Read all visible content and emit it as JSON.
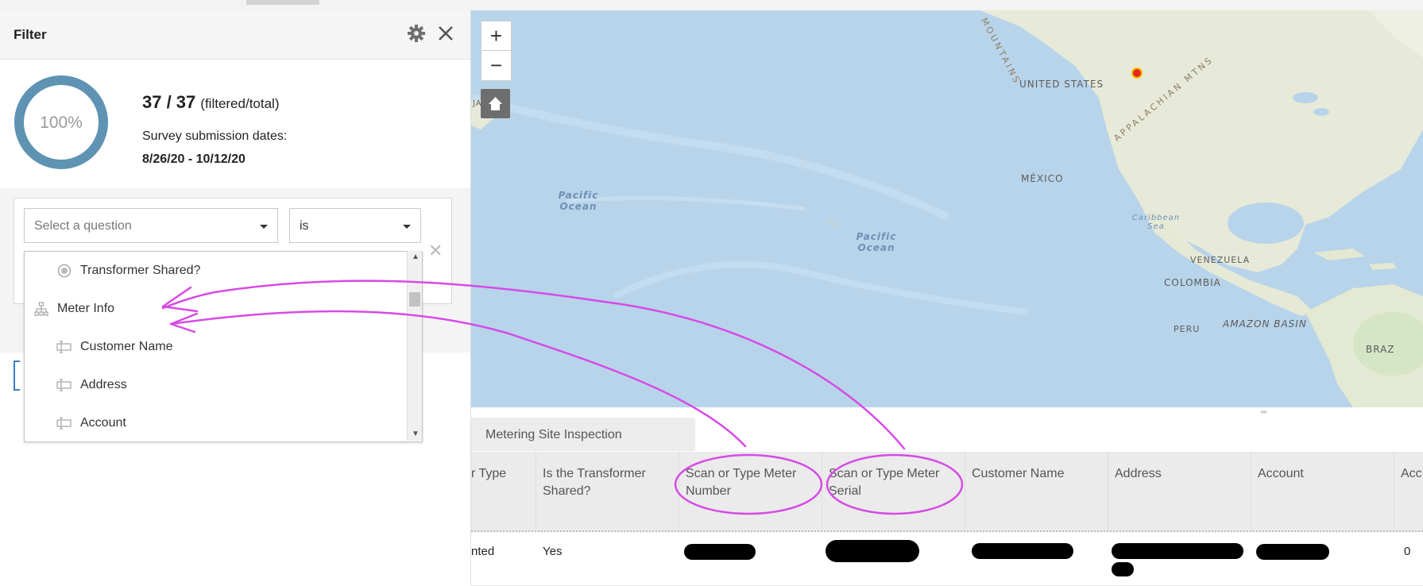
{
  "filter_panel": {
    "title": "Filter",
    "progress": {
      "percent_label": "100%",
      "percent": 100,
      "counts": "37 / 37",
      "counts_suffix": "(filtered/total)",
      "dates_label": "Survey submission dates:",
      "dates_value": "8/26/20 - 10/12/20"
    },
    "question_select": {
      "value": "Select a question"
    },
    "operator_select": {
      "value": "is"
    },
    "dropdown_items": [
      {
        "label": "Transformer Shared?",
        "icon": "radio-icon"
      },
      {
        "label": "Meter Info",
        "icon": "group-icon"
      },
      {
        "label": "Customer Name",
        "icon": "text-field-icon"
      },
      {
        "label": "Address",
        "icon": "text-field-icon"
      },
      {
        "label": "Account",
        "icon": "text-field-icon"
      }
    ]
  },
  "map": {
    "labels": {
      "united_states": "UNITED STATES",
      "mexico": "MÉXICO",
      "pacific1": "Pacific Ocean",
      "pacific2": "Pacific Ocean",
      "caribbean": "Caribbean Sea",
      "venezuela": "VENEZUELA",
      "colombia": "COLOMBIA",
      "peru": "PERU",
      "amazon": "AMAZON BASIN",
      "brazil": "BRAZ",
      "japan": "JAPAN",
      "mountains": "MOUNTAINS",
      "appalachian": "APPALACHIAN MTNS"
    },
    "colors": {
      "ocean": "#b8d4ea",
      "land": "#e8ebdc",
      "marker": "#e8261f"
    }
  },
  "table": {
    "tab_label": "Metering Site Inspection",
    "columns": [
      "r Type",
      "Is the Transformer Shared?",
      "Scan or Type Meter Number",
      "Scan or Type Meter Serial",
      "Customer Name",
      "Address",
      "Account",
      "Acc"
    ],
    "row": {
      "type": "nted",
      "shared": "Yes",
      "last": "0"
    }
  },
  "annotation_color": "#d64be6"
}
